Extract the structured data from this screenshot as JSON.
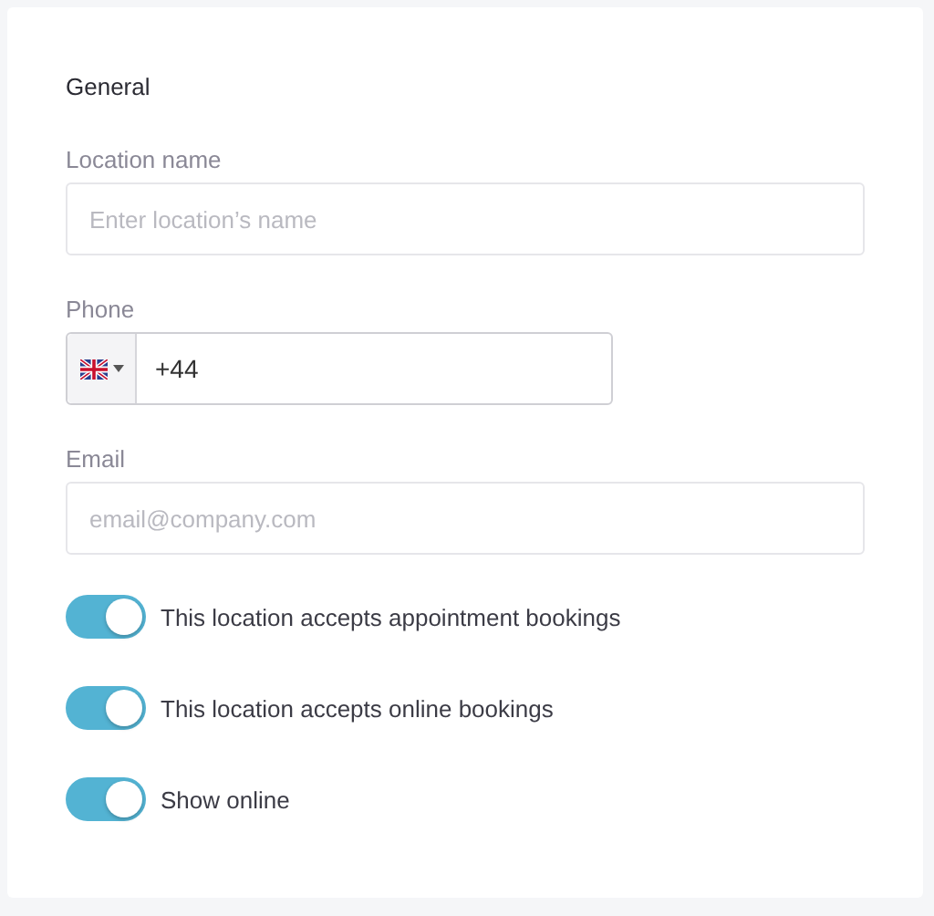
{
  "section": {
    "title": "General"
  },
  "fields": [
    {
      "kind": "text",
      "label": "Location name",
      "placeholder": "Enter location’s name"
    },
    {
      "kind": "phone",
      "label": "Phone",
      "value": "+44"
    },
    {
      "kind": "text",
      "label": "Email",
      "placeholder": "email@company.com"
    }
  ],
  "toggles": [
    {
      "label": "This location accepts appointment bookings",
      "on": true
    },
    {
      "label": "This location accepts online bookings",
      "on": true
    },
    {
      "label": "Show online",
      "on": true
    }
  ]
}
